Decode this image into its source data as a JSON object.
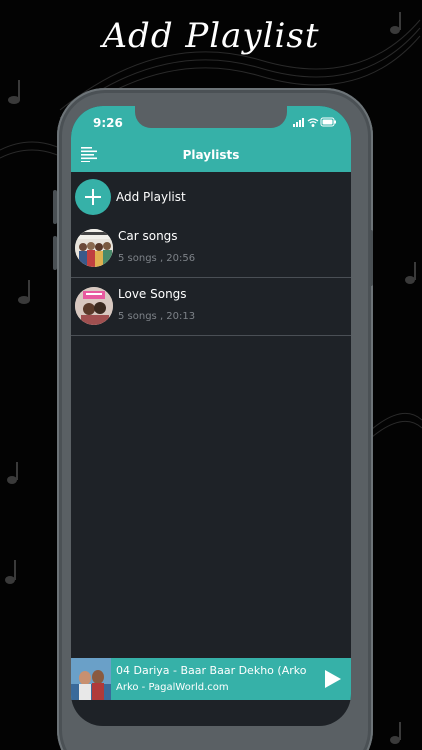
{
  "promo": {
    "headline": "Add Playlist"
  },
  "status_bar": {
    "time": "9:26",
    "icons": [
      "signal-icon",
      "wifi-icon",
      "battery-icon"
    ]
  },
  "header": {
    "title": "Playlists",
    "menu_icon": "menu-icon"
  },
  "add_playlist": {
    "label": "Add Playlist",
    "icon": "plus-icon"
  },
  "playlists": [
    {
      "name": "Car songs",
      "meta": "5 songs , 20:56"
    },
    {
      "name": "Love Songs",
      "meta": "5 songs , 20:13"
    }
  ],
  "now_playing": {
    "title": "04 Dariya - Baar Baar Dekho (Arko",
    "subtitle": "Arko - PagalWorld.com",
    "play_icon": "play-icon"
  },
  "colors": {
    "accent": "#36b1a8",
    "screen_bg": "#1e2227",
    "divider": "#4a4f55",
    "meta_text": "#7d8288",
    "frame": "#5a6064"
  }
}
